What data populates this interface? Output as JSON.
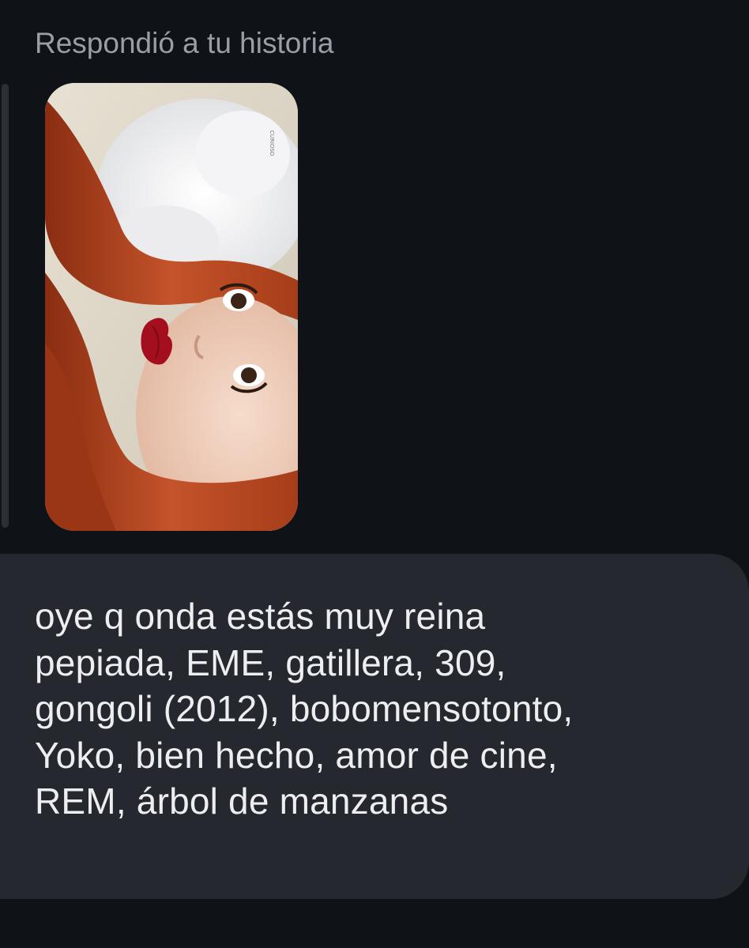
{
  "conversation": {
    "reply_context_label": "Respondió a tu historia",
    "story_thumbnail": {
      "icon": "story-photo",
      "accent_colors": {
        "hair": "#b7461f",
        "lips": "#a30f1e",
        "background": "#d9d2c5"
      }
    },
    "message": {
      "text": "oye q onda estás muy reina\npepiada, EME, gatillera, 309,\ngongoli (2012), bobomensotonto,\nYoko, bien hecho, amor de cine,\nREM, árbol de manzanas"
    }
  },
  "theme": {
    "background": "#0f1216",
    "bubble": "#25282e",
    "text": "#eceef0",
    "muted_text": "#9a9ea6"
  }
}
